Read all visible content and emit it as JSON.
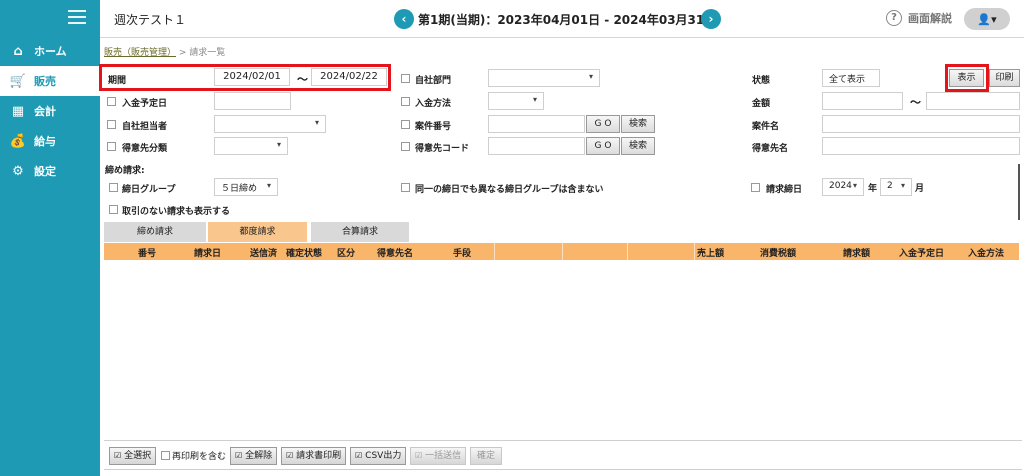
{
  "sidebar": {
    "items": [
      {
        "label": "ホーム",
        "icon": "home-icon",
        "glyph": "⌂"
      },
      {
        "label": "販売",
        "icon": "cart-icon",
        "glyph": "🛒"
      },
      {
        "label": "会計",
        "icon": "calculator-icon",
        "glyph": "▦"
      },
      {
        "label": "給与",
        "icon": "money-bag-icon",
        "glyph": "💰"
      },
      {
        "label": "設定",
        "icon": "gear-icon",
        "glyph": "⚙"
      }
    ],
    "active_index": 1
  },
  "header": {
    "app_title": "週次テスト１",
    "period": "第1期(当期)：2023年04月01日 - 2024年03月31日",
    "prev_glyph": "‹",
    "next_glyph": "›",
    "help_label": "画面解説",
    "user_glyph": "👤▾"
  },
  "breadcrumb": {
    "link": "販売（販売管理）",
    "sep": " > ",
    "current": "請求一覧"
  },
  "form": {
    "period_label": "期間",
    "period_from": "2024/02/01",
    "period_to": "2024/02/22",
    "tilde": "〜",
    "own_dept_label": "自社部門",
    "status_label": "状態",
    "status_value": "全て表示",
    "show_button": "表示",
    "print_button": "印刷",
    "due_date_label": "入金予定日",
    "payment_method_label": "入金方法",
    "amount_label": "金額",
    "staff_label": "自社担当者",
    "case_no_label": "案件番号",
    "case_name_label": "案件名",
    "customer_class_label": "得意先分類",
    "customer_code_label": "得意先コード",
    "customer_name_label": "得意先名",
    "go_label": "G O",
    "search_label": "検索",
    "closing_title": "締め請求:",
    "closing_group_label": "締日グループ",
    "closing_group_value": "５日締め",
    "same_day_label": "同一の締日でも異なる締日グループは含まない",
    "billing_day_label": "請求締日",
    "year_value": "2024",
    "year_unit": "年",
    "month_value": "2",
    "month_unit": "月",
    "no_deal_label": "取引のない請求も表示する"
  },
  "tabs": [
    "締め請求",
    "都度請求",
    "合算請求"
  ],
  "active_tab": 1,
  "table": {
    "columns": [
      "番号",
      "請求日",
      "送信済",
      "確定状態",
      "区分",
      "得意先名",
      "手段",
      "",
      "",
      "",
      "",
      "売上額",
      "消費税額",
      "請求額",
      "入金予定日",
      "入金方法"
    ],
    "rows": []
  },
  "footer": {
    "select_all": "全選択",
    "include_printed": "再印刷を含む",
    "deselect_all": "全解除",
    "print_invoice": "請求書印刷",
    "csv_export": "CSV出力",
    "bulk_send": "一括送信",
    "confirm": "確定"
  },
  "colors": {
    "sidebar": "#1f9ab4",
    "table_header": "#f9b56a",
    "active_tab": "#f9c78d",
    "highlight": "#e3151a"
  }
}
